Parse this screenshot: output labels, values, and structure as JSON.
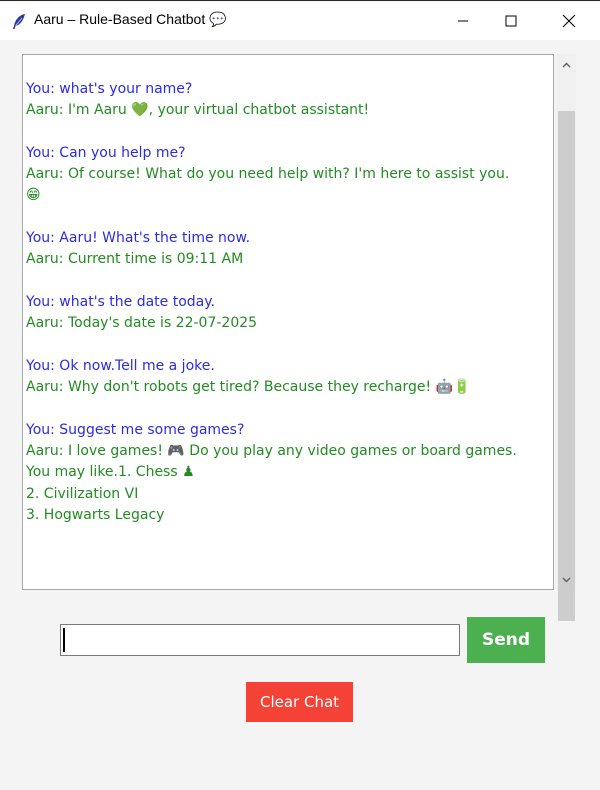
{
  "window": {
    "title": "Aaru – Rule-Based Chatbot 💬",
    "app_icon": "feather-icon"
  },
  "chat": {
    "lines": [
      {
        "role": "user",
        "text": "You: what's your name?"
      },
      {
        "role": "bot",
        "text": "Aaru: I'm Aaru 💚, your virtual chatbot assistant!"
      },
      {
        "role": "blank",
        "text": ""
      },
      {
        "role": "user",
        "text": "You: Can you help me?"
      },
      {
        "role": "bot",
        "text": "Aaru: Of course! What do you need help with? I'm here to assist you."
      },
      {
        "role": "bot",
        "text": "😁"
      },
      {
        "role": "blank",
        "text": ""
      },
      {
        "role": "user",
        "text": "You: Aaru! What's the time now."
      },
      {
        "role": "bot",
        "text": "Aaru: Current time is 09:11 AM"
      },
      {
        "role": "blank",
        "text": ""
      },
      {
        "role": "user",
        "text": "You: what's the date today."
      },
      {
        "role": "bot",
        "text": "Aaru: Today's date is 22-07-2025"
      },
      {
        "role": "blank",
        "text": ""
      },
      {
        "role": "user",
        "text": "You: Ok now.Tell me a joke."
      },
      {
        "role": "bot",
        "text": "Aaru: Why don't robots get tired? Because they recharge! 🤖🔋"
      },
      {
        "role": "blank",
        "text": ""
      },
      {
        "role": "user",
        "text": "You: Suggest me some games?"
      },
      {
        "role": "bot",
        "text": "Aaru: I love games! 🎮 Do you play any video games or board games."
      },
      {
        "role": "bot",
        "text": "You may like.1. Chess ♟"
      },
      {
        "role": "bot",
        "text": "2. Civilization VI"
      },
      {
        "role": "bot",
        "text": "3. Hogwarts Legacy"
      }
    ],
    "colors": {
      "user": "#2b2be0",
      "bot": "#228b22"
    }
  },
  "input": {
    "value": "",
    "placeholder": ""
  },
  "buttons": {
    "send_label": "Send",
    "send_color": "#4caf50",
    "clear_label": "Clear Chat",
    "clear_color": "#f44336"
  }
}
